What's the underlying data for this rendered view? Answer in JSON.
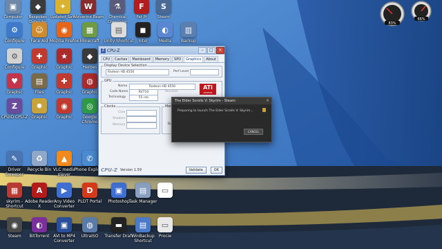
{
  "desktop": {
    "icons": [
      {
        "label": "Computer",
        "color": "#6f88a8",
        "glyph": "▣",
        "col": 0,
        "row": 0
      },
      {
        "label": "Bespoken Defender",
        "color": "#3b3b3b",
        "glyph": "◆",
        "col": 1,
        "row": 0
      },
      {
        "label": "Updated Safe SD",
        "color": "#d9b230",
        "glyph": "✦",
        "col": 2,
        "row": 0
      },
      {
        "label": "Wolverine Beam",
        "color": "#8a2b2b",
        "glyph": "W",
        "col": 3,
        "row": 0
      },
      {
        "label": "Chemical Chemistry",
        "color": "#5a5a7a",
        "glyph": "⚗",
        "col": 4,
        "row": 0
      },
      {
        "label": "Fat Pl",
        "color": "#b21e1e",
        "glyph": "F",
        "col": 5,
        "row": 0
      },
      {
        "label": "Steam",
        "color": "#4a6a96",
        "glyph": "S",
        "col": 6,
        "row": 0
      },
      {
        "label": "Configure",
        "color": "#3f79c9",
        "glyph": "⚙",
        "col": 0,
        "row": 1
      },
      {
        "label": "Face Aid",
        "color": "#d08a2e",
        "glyph": "☺",
        "col": 1,
        "row": 1
      },
      {
        "label": "Mozilla Firefox",
        "color": "#e4661a",
        "glyph": "◉",
        "col": 2,
        "row": 1
      },
      {
        "label": "Minecraft",
        "color": "#6e9a43",
        "glyph": "▦",
        "col": 3,
        "row": 1
      },
      {
        "label": "Unity Shortcut",
        "color": "#dddddd",
        "glyph": "▤",
        "col": 4,
        "row": 1
      },
      {
        "label": "Intel",
        "color": "#222222",
        "glyph": "◼",
        "col": 5,
        "row": 1
      },
      {
        "label": "Media",
        "color": "#5b86d1",
        "glyph": "◐",
        "col": 6,
        "row": 1
      },
      {
        "label": "Backup",
        "color": "#5b7fae",
        "glyph": "▥",
        "col": 7,
        "row": 1
      },
      {
        "label": "Configure",
        "color": "#d2d2d2",
        "glyph": "⚙",
        "col": 0,
        "row": 2
      },
      {
        "label": "Graphic",
        "color": "#c03a2f",
        "glyph": "✚",
        "col": 1,
        "row": 2
      },
      {
        "label": "Graphic",
        "color": "#aa2b2b",
        "glyph": "★",
        "col": 2,
        "row": 2
      },
      {
        "label": "Heroes",
        "color": "#3b3b3b",
        "glyph": "◆",
        "col": 3,
        "row": 2
      },
      {
        "label": "Graphic",
        "color": "#c2364d",
        "glyph": "♥",
        "col": 0,
        "row": 3
      },
      {
        "label": "Files",
        "color": "#7a6a4a",
        "glyph": "▤",
        "col": 1,
        "row": 3
      },
      {
        "label": "Graphic",
        "color": "#c03a2f",
        "glyph": "✚",
        "col": 2,
        "row": 3
      },
      {
        "label": "Graphic",
        "color": "#aa2b2b",
        "glyph": "◍",
        "col": 3,
        "row": 3
      },
      {
        "label": "CPUID CPU-Z",
        "color": "#6a4c9c",
        "glyph": "Z",
        "col": 0,
        "row": 4
      },
      {
        "label": "Graphic",
        "color": "#c8a23a",
        "glyph": "✹",
        "col": 1,
        "row": 4
      },
      {
        "label": "Graphic",
        "color": "#c03a2f",
        "glyph": "◉",
        "col": 2,
        "row": 4
      },
      {
        "label": "Google Chrome",
        "color": "#2f9a45",
        "glyph": "◎",
        "col": 3,
        "row": 4
      },
      {
        "label": "Driver Sweeper",
        "color": "#4b74b3",
        "glyph": "✎",
        "col": 0,
        "row": 5
      },
      {
        "label": "Recycle Bin",
        "color": "#8fa7c8",
        "glyph": "♻",
        "col": 1,
        "row": 5
      },
      {
        "label": "VLC media player",
        "color": "#f08a1c",
        "glyph": "▲",
        "col": 2,
        "row": 5
      },
      {
        "label": "Phone Explorer",
        "color": "#4a8ad1",
        "glyph": "✆",
        "col": 3,
        "row": 5
      },
      {
        "label": "Photosho",
        "color": "#2a3f7a",
        "glyph": "Ps",
        "col": 4,
        "row": 5
      },
      {
        "label": "skyrim - Shortcut",
        "color": "#b73a33",
        "glyph": "▦",
        "col": 0,
        "row": 6
      },
      {
        "label": "Adobe Reader X",
        "color": "#b31b1b",
        "glyph": "A",
        "col": 1,
        "row": 6
      },
      {
        "label": "Any Video Converter",
        "color": "#3f6fd1",
        "glyph": "▶",
        "col": 2,
        "row": 6
      },
      {
        "label": "PLDT Portal",
        "color": "#d43a1a",
        "glyph": "D",
        "col": 3,
        "row": 6
      },
      {
        "label": "Photoshop",
        "color": "#3f6fd1",
        "glyph": "▣",
        "col": 4,
        "row": 6
      },
      {
        "label": "Task Manager",
        "color": "#8aa0c0",
        "glyph": "▤",
        "col": 5,
        "row": 6
      },
      {
        "label": "",
        "color": "#ffffff",
        "glyph": "▭",
        "col": 6,
        "row": 6
      },
      {
        "label": "Steam",
        "color": "#4a4a4a",
        "glyph": "◉",
        "col": 0,
        "row": 7
      },
      {
        "label": "BitTorrent",
        "color": "#7a2f9a",
        "glyph": "◐",
        "col": 1,
        "row": 7
      },
      {
        "label": "AVI to MP4 Converter",
        "color": "#2a4f9a",
        "glyph": "▣",
        "col": 2,
        "row": 7
      },
      {
        "label": "UltraISO",
        "color": "#5a7aa8",
        "glyph": "◍",
        "col": 3,
        "row": 7
      },
      {
        "label": "Transfer Draft",
        "color": "#222222",
        "glyph": "▬",
        "col": 4,
        "row": 7
      },
      {
        "label": "WinBackup Shortcut",
        "color": "#4a7ac8",
        "glyph": "▤",
        "col": 5,
        "row": 7
      },
      {
        "label": "Procie",
        "color": "#e8e8e8",
        "glyph": "▭",
        "col": 6,
        "row": 7
      }
    ]
  },
  "cpuz": {
    "title": "CPU-Z",
    "logo": "Z",
    "tabs": [
      "CPU",
      "Caches",
      "Mainboard",
      "Memory",
      "SPD",
      "Graphics",
      "About"
    ],
    "active_tab": "Graphics",
    "display_device_title": "Display Device Selection",
    "device_value": "Radeon HD 4550",
    "perf_level_label": "Perf Level",
    "gpu_title": "GPU",
    "name_label": "Name",
    "name_value": "Radeon HD 4550",
    "codename_label": "Code Name",
    "codename_value": "RV710",
    "revision_label": "Revision",
    "technology_label": "Technology",
    "technology_value": "55 nm",
    "clocks_title": "Clocks",
    "core_label": "Core",
    "shaders_label": "Shaders",
    "memory_clk_label": "Memory",
    "memory_title": "Memory",
    "bus_label": "Bus",
    "brand": "CPU-Z",
    "version": "Version 1.59",
    "validate_label": "Validate",
    "ok_label": "OK",
    "ati_text": "ATi",
    "ati_sub": "RADEON"
  },
  "skyrim": {
    "title": "The Elder Scrolls V: Skyrim - Steam",
    "message": "Preparing to launch The Elder Scrolls V: Skyrim...",
    "cancel_label": "CANCEL"
  },
  "gadget": {
    "cpu_percent": "83%",
    "ram_percent": "66%"
  }
}
